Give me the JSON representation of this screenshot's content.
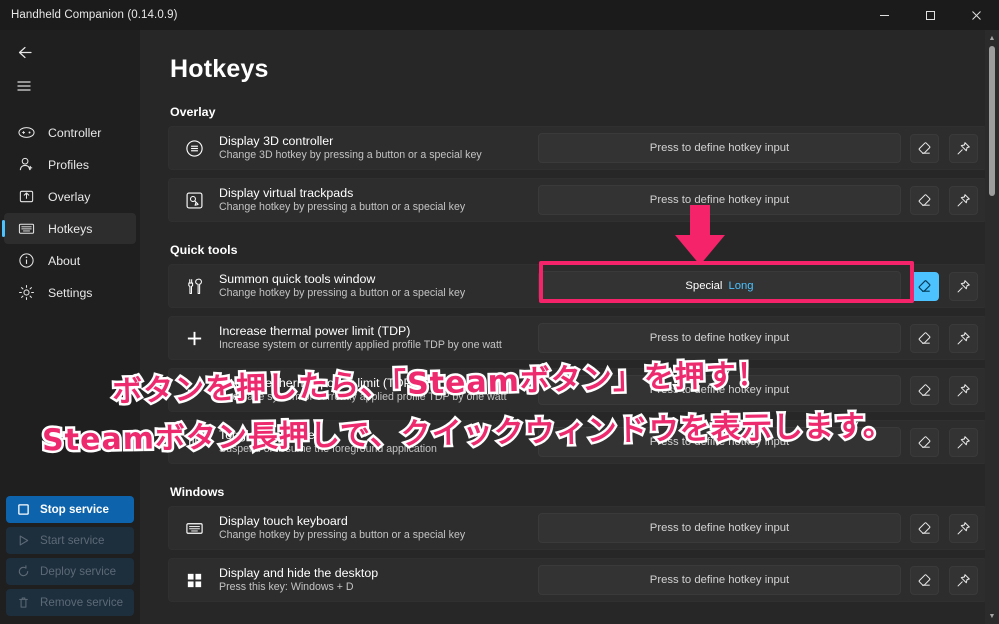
{
  "window": {
    "title": "Handheld Companion (0.14.0.9)",
    "controls": [
      {
        "name": "minimize",
        "glyph": "minimize-icon"
      },
      {
        "name": "maximize",
        "glyph": "maximize-icon"
      },
      {
        "name": "close",
        "glyph": "close-icon"
      }
    ]
  },
  "sidebar": {
    "back_icon": "back-arrow-icon",
    "menu_icon": "hamburger-menu-icon",
    "items": [
      {
        "label": "Controller",
        "icon": "controller-icon",
        "selected": false
      },
      {
        "label": "Profiles",
        "icon": "profiles-person-icon",
        "selected": false
      },
      {
        "label": "Overlay",
        "icon": "overlay-icon",
        "selected": false
      },
      {
        "label": "Hotkeys",
        "icon": "keyboard-icon",
        "selected": true
      },
      {
        "label": "About",
        "icon": "info-circle-icon",
        "selected": false
      },
      {
        "label": "Settings",
        "icon": "gear-icon",
        "selected": false
      }
    ],
    "service_buttons": [
      {
        "label": "Stop service",
        "icon": "stop-square-icon",
        "state": "primary"
      },
      {
        "label": "Start service",
        "icon": "play-triangle-icon",
        "state": "disabled"
      },
      {
        "label": "Deploy service",
        "icon": "refresh-circle-icon",
        "state": "disabled"
      },
      {
        "label": "Remove service",
        "icon": "trash-icon",
        "state": "disabled"
      }
    ]
  },
  "page": {
    "title": "Hotkeys",
    "placeholder_hotkey": "Press to define hotkey input",
    "sections": [
      {
        "heading": "Overlay",
        "rows": [
          {
            "title": "Display 3D controller",
            "desc": "Change 3D hotkey by pressing a button or a special key",
            "icon": "menu-circle-icon",
            "value": "Press to define hotkey input",
            "assigned": false,
            "modifier": "",
            "erase_icon": "eraser-icon",
            "pin_icon": "pin-icon",
            "erase_active": false
          },
          {
            "title": "Display virtual trackpads",
            "desc": "Change hotkey by pressing a button or a special key",
            "icon": "trackpad-touch-icon",
            "value": "Press to define hotkey input",
            "assigned": false,
            "modifier": "",
            "erase_icon": "eraser-icon",
            "pin_icon": "pin-icon",
            "erase_active": false
          }
        ]
      },
      {
        "heading": "Quick tools",
        "rows": [
          {
            "title": "Summon quick tools window",
            "desc": "Change hotkey by pressing a button or a special key",
            "icon": "tools-icon",
            "value": "Special",
            "assigned": true,
            "modifier": "Long",
            "erase_icon": "eraser-icon",
            "pin_icon": "pin-icon",
            "erase_active": true,
            "highlighted": true
          },
          {
            "title": "Increase thermal power limit (TDP)",
            "desc": "Increase system or currently applied profile TDP by one watt",
            "icon": "plus-icon",
            "value": "Press to define hotkey input",
            "assigned": false,
            "modifier": "",
            "erase_icon": "eraser-icon",
            "pin_icon": "pin-icon",
            "erase_active": false
          },
          {
            "title": "Decrease thermal power limit (TDP)",
            "desc": "Decrease system or currently applied profile TDP by one watt",
            "icon": "minus-icon",
            "value": "Press to define hotkey input",
            "assigned": false,
            "modifier": "",
            "erase_icon": "eraser-icon",
            "pin_icon": "pin-icon",
            "erase_active": false
          },
          {
            "title": "Toggle Suspender",
            "desc": "Suspend or resume the foreground application",
            "icon": "pause-icon",
            "value": "Press to define hotkey input",
            "assigned": false,
            "modifier": "",
            "erase_icon": "eraser-icon",
            "pin_icon": "pin-icon",
            "erase_active": false
          }
        ]
      },
      {
        "heading": "Windows",
        "rows": [
          {
            "title": "Display touch keyboard",
            "desc": "Change hotkey by pressing a button or a special key",
            "icon": "touch-keyboard-icon",
            "value": "Press to define hotkey input",
            "assigned": false,
            "modifier": "",
            "erase_icon": "eraser-icon",
            "pin_icon": "pin-icon",
            "erase_active": false
          },
          {
            "title": "Display and hide the desktop",
            "desc": "Press this key: Windows + D",
            "icon": "windows-desktop-icon",
            "value": "Press to define hotkey input",
            "assigned": false,
            "modifier": "",
            "erase_icon": "eraser-icon",
            "pin_icon": "pin-icon",
            "erase_active": false
          }
        ]
      }
    ]
  },
  "annotations": {
    "arrow_icon": "down-arrow-annotation",
    "line1": "ボタンを押したら、「Steamボタン」を押す！",
    "line2": "Steamボタン長押しで、クイックウィンドウを表示します。",
    "color": "#ee2a6e",
    "highlight_color": "#f5246a"
  },
  "scrollbar": {
    "up_arrow": "scroll-up-arrow",
    "down_arrow": "scroll-down-arrow"
  }
}
